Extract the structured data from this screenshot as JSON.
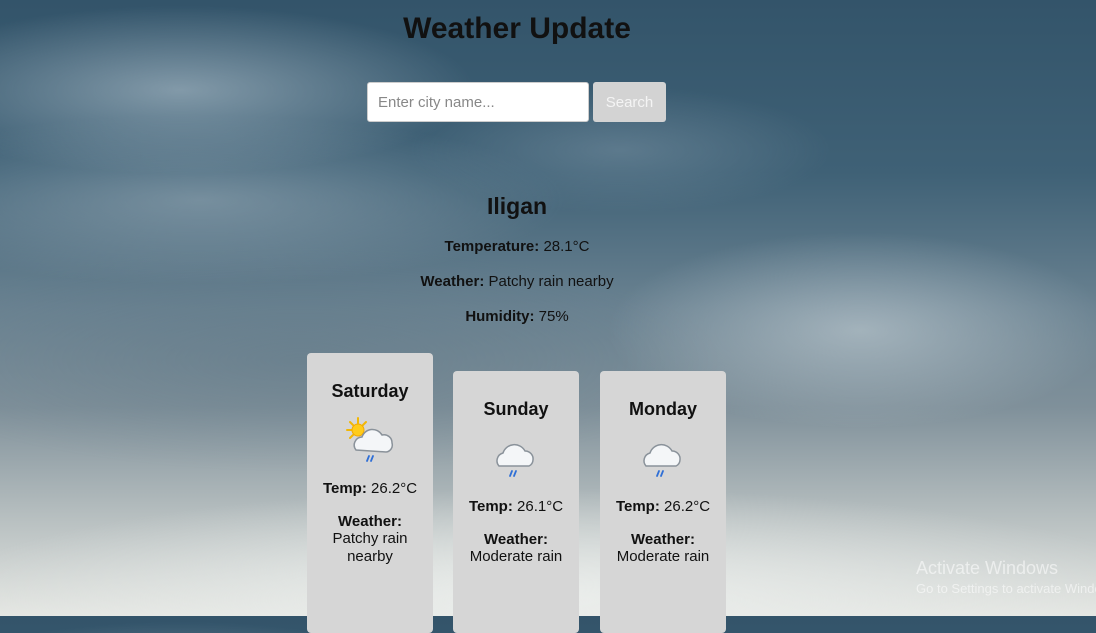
{
  "header": {
    "title": "Weather Update"
  },
  "search": {
    "placeholder": "Enter city name...",
    "value": "",
    "button_label": "Search"
  },
  "current": {
    "city": "Iligan",
    "temperature_label": "Temperature:",
    "temperature_value": "28.1°C",
    "weather_label": "Weather:",
    "weather_value": "Patchy rain nearby",
    "humidity_label": "Humidity:",
    "humidity_value": "75%"
  },
  "forecast": [
    {
      "day": "Saturday",
      "icon": "sun-cloud-rain-icon",
      "temp_label": "Temp:",
      "temp": "26.2°C",
      "weather_label": "Weather:",
      "weather": "Patchy rain nearby"
    },
    {
      "day": "Sunday",
      "icon": "cloud-rain-icon",
      "temp_label": "Temp:",
      "temp": "26.1°C",
      "weather_label": "Weather:",
      "weather": "Moderate rain"
    },
    {
      "day": "Monday",
      "icon": "cloud-rain-icon",
      "temp_label": "Temp:",
      "temp": "26.2°C",
      "weather_label": "Weather:",
      "weather": "Moderate rain"
    }
  ],
  "watermark": {
    "line1": "Activate Windows",
    "line2": "Go to Settings to activate Windows."
  }
}
